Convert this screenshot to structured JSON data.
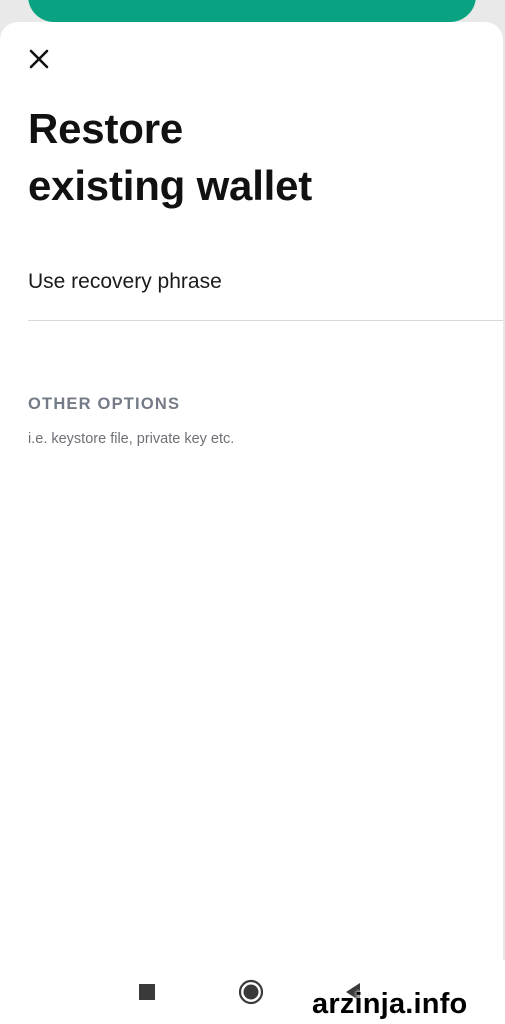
{
  "sheet": {
    "close_icon": "close-icon",
    "title_line1": "Restore",
    "title_line2": "existing wallet"
  },
  "options": {
    "recovery_phrase_label": "Use recovery phrase",
    "other_heading": "OTHER OPTIONS",
    "other_subtitle": "i.e. keystore file, private key etc."
  },
  "nav_bar": {
    "recents_icon": "square-icon",
    "home_icon": "circle-icon",
    "back_icon": "triangle-back-icon"
  },
  "watermark": {
    "text": "arzinja.info"
  },
  "colors": {
    "accent_button": "#0aa382",
    "title_text": "#111111",
    "heading_gray": "#747b86"
  }
}
